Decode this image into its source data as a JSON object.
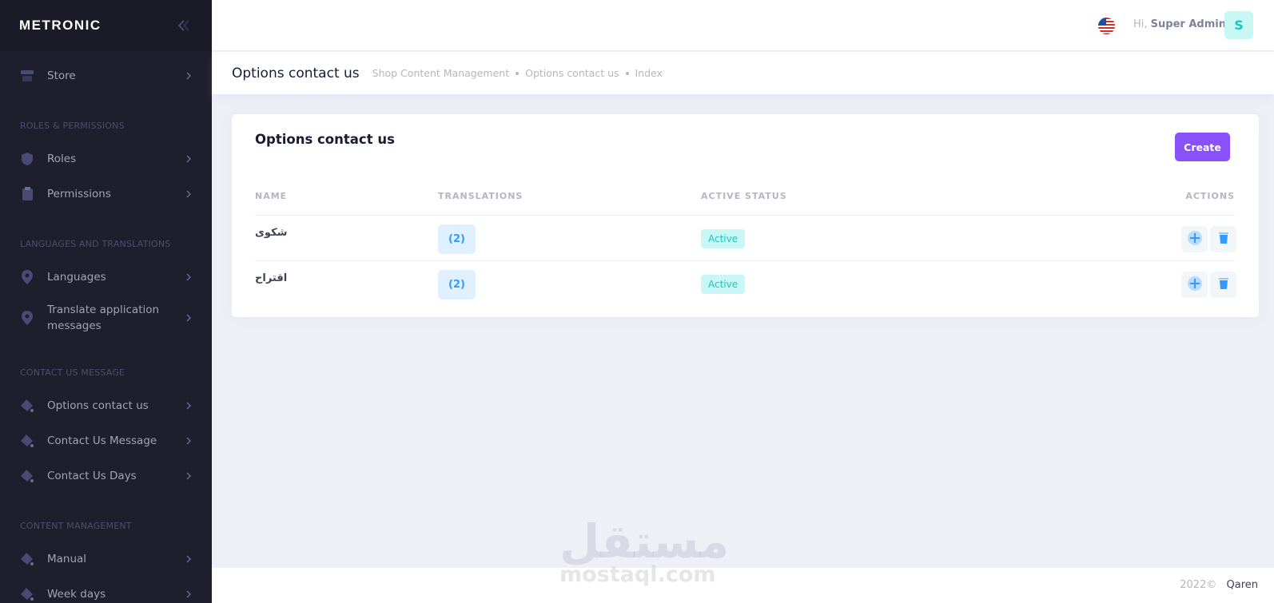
{
  "brand": {
    "logo": "METRONIC"
  },
  "sidebar": {
    "store": {
      "label": "Store",
      "icon": "store-icon"
    },
    "sections": {
      "roles": "ROLES & PERMISSIONS",
      "languages": "LANGUAGES AND TRANSLATIONS",
      "contact": "CONTACT US MESSAGE",
      "content": "CONTENT MANAGEMENT"
    },
    "items": {
      "roles": "Roles",
      "permissions": "Permissions",
      "languages": "Languages",
      "translate": "Translate application messages",
      "options_contact": "Options contact us",
      "contact_message": "Contact Us Message",
      "contact_days": "Contact Us Days",
      "manual": "Manual",
      "week_days": "Week days"
    }
  },
  "header": {
    "greeting": "Hi,",
    "user_name": "Super Admin",
    "avatar_letter": "S"
  },
  "subheader": {
    "title": "Options contact us",
    "breadcrumb": [
      "Shop Content Management",
      "Options contact us",
      "Index"
    ]
  },
  "card": {
    "title": "Options contact us",
    "create_label": "Create",
    "columns": [
      "NAME",
      "TRANSLATIONS",
      "ACTIVE STATUS",
      "ACTIONS"
    ],
    "rows": [
      {
        "name": "شكوى",
        "translations": "(2)",
        "status": "Active"
      },
      {
        "name": "اقتراح",
        "translations": "(2)",
        "status": "Active"
      }
    ]
  },
  "footer": {
    "year": "2022©",
    "owner": "Qaren"
  },
  "watermark": {
    "arabic": "مستقل",
    "latin": "mostaql.com"
  },
  "colors": {
    "primary": "#8950fc",
    "info": "#3699ff",
    "success": "#1bc5bd",
    "sidebar_bg": "#1e1e2d"
  }
}
